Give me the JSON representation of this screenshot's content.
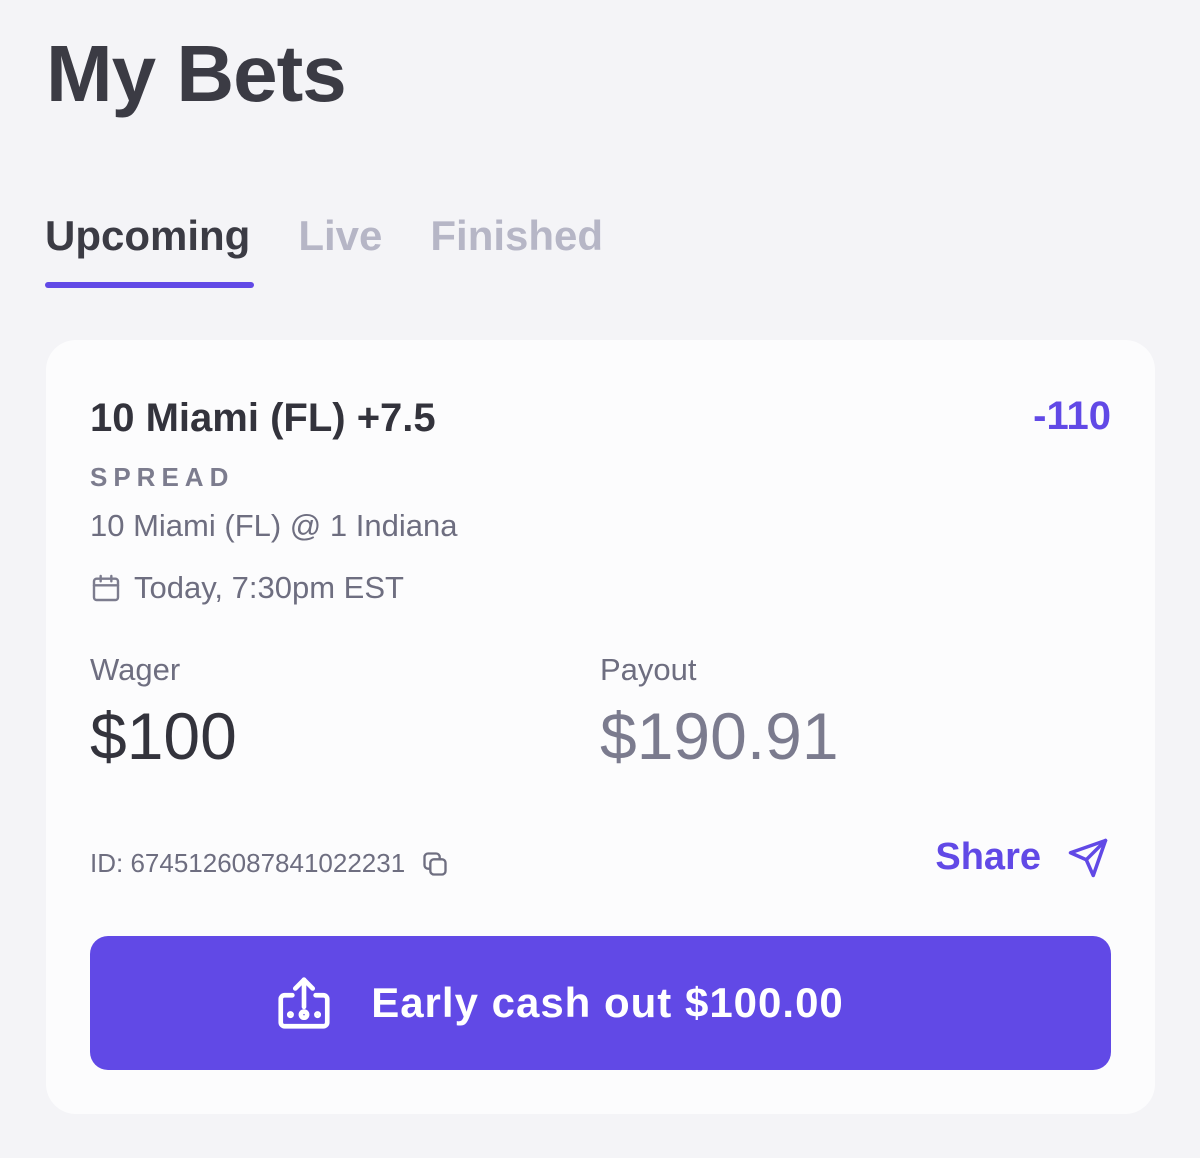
{
  "header": {
    "title": "My Bets"
  },
  "tabs": [
    {
      "label": "Upcoming",
      "active": true
    },
    {
      "label": "Live",
      "active": false
    },
    {
      "label": "Finished",
      "active": false
    }
  ],
  "bet": {
    "title": "10 Miami (FL) +7.5",
    "odds": "-110",
    "type": "SPREAD",
    "matchup": "10 Miami (FL) @ 1 Indiana",
    "datetime": "Today, 7:30pm EST",
    "wager_label": "Wager",
    "wager_amount": "$100",
    "payout_label": "Payout",
    "payout_amount": "$190.91",
    "id_text": "ID: 6745126087841022231",
    "share_label": "Share",
    "cashout_label": "Early cash out $100.00"
  },
  "colors": {
    "accent": "#6149e6",
    "background": "#f4f4f7",
    "card": "#fcfcfd",
    "muted_text": "#6e6e80"
  },
  "icons": {
    "calendar": "calendar-icon",
    "copy": "copy-icon",
    "share": "send-icon",
    "cashout": "cash-out-icon"
  }
}
